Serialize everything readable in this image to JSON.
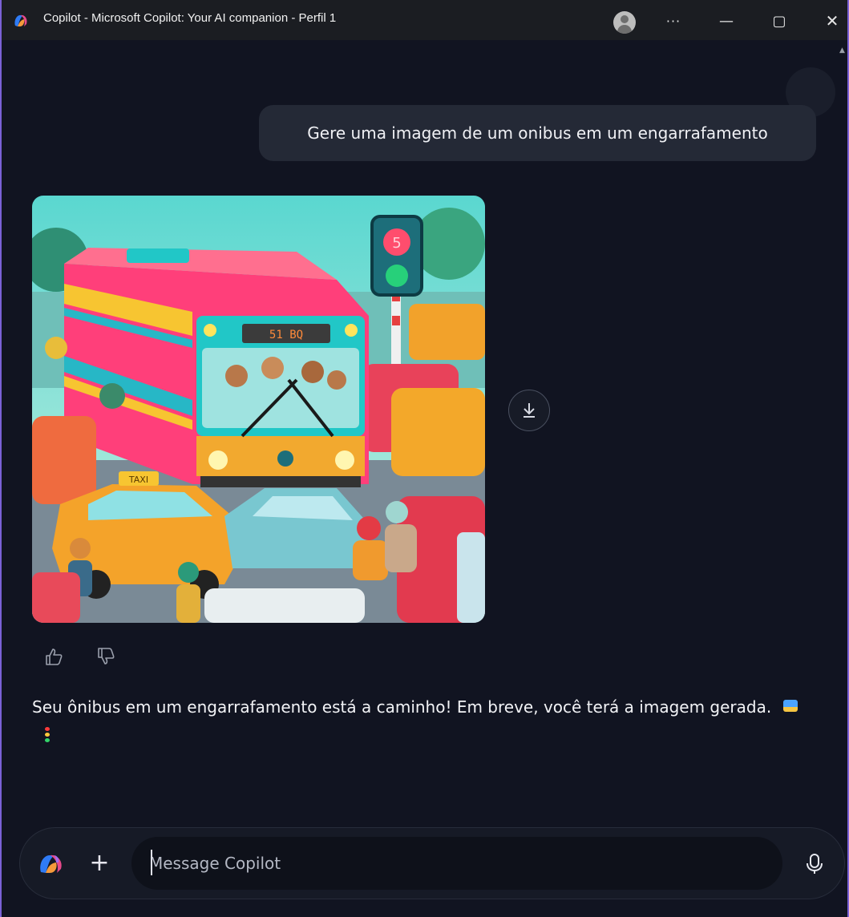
{
  "window": {
    "title": "Copilot - Microsoft Copilot: Your AI companion - Perfil 1",
    "more_label": "···",
    "minimize_label": "—",
    "maximize_label": "▢",
    "close_label": "✕"
  },
  "conversation": {
    "user_message": "Gere uma imagem de um onibus em um engarrafamento",
    "assistant_message": "Seu ônibus em um engarrafamento está a caminho! Em breve, você terá a imagem gerada."
  },
  "generated_image": {
    "bus_sign": "51 BQ",
    "traffic_light_number": "5",
    "taxi_sign": "TAXI"
  },
  "composer": {
    "plus_label": "+",
    "placeholder": "Message Copilot"
  },
  "icons": {
    "app": "copilot-logo-icon",
    "download": "download-icon",
    "like": "thumbs-up-icon",
    "dislike": "thumbs-down-icon",
    "mic": "microphone-icon"
  },
  "colors": {
    "background": "#111421",
    "bubble": "#242936",
    "accent_border": "#7b61d6"
  }
}
